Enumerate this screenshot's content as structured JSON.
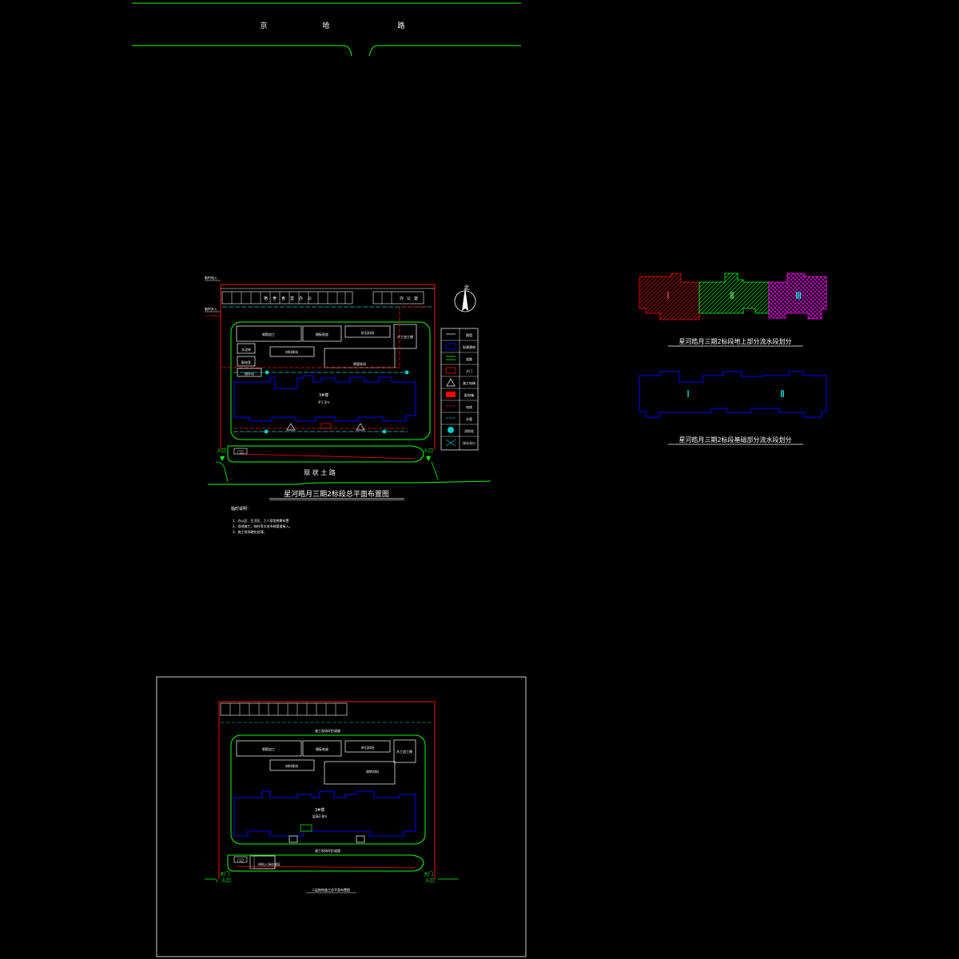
{
  "road_top": {
    "chars": [
      "京",
      "哈",
      "路"
    ]
  },
  "main_plan": {
    "title": "星河皓月三期2标段总平面布置图",
    "road_label": "现 状 土 路",
    "building_name": "3#楼",
    "building_area": "平1.5m",
    "north": "北",
    "entrance_left": "入口",
    "entrance_right": "入口",
    "gate_label": "门卫",
    "top_row_labels": [
      "宿",
      "舍",
      "食",
      "堂",
      "办",
      "公"
    ],
    "top_right_labels": [
      "办",
      "公",
      "室"
    ],
    "left_edge_labels": [
      "临时电入",
      "临时水入"
    ],
    "sheds": [
      "钢筋加工",
      "模板堆放",
      "砂石料场",
      "木工加工棚",
      "材料堆场",
      "钢管堆场"
    ],
    "small_labels": [
      "水泥库",
      "配电室",
      "搅拌站"
    ],
    "legend": [
      {
        "label": "围墙"
      },
      {
        "label": "拟建建筑"
      },
      {
        "label": "道路"
      },
      {
        "label": "大门"
      },
      {
        "label": "施工电梯"
      },
      {
        "label": "配电箱"
      },
      {
        "label": "电线"
      },
      {
        "label": "水管"
      },
      {
        "label": "消防栓"
      },
      {
        "label": "排水沟口"
      }
    ],
    "notes_title": "临时说明：",
    "notes": [
      "1、办公区、生活区、工人宿舍统筹布置",
      "2、场地施工，临时用水由市政管道接入。",
      "3、施工现场硬化处理。"
    ]
  },
  "plan_ground": {
    "title": "星河皓月三期2标段地上部分流水段划分",
    "sections": [
      "Ⅰ",
      "Ⅱ",
      "Ⅲ"
    ]
  },
  "plan_found": {
    "title": "星河皓月三期2标段基础部分流水段划分",
    "sections": [
      "Ⅰ",
      "Ⅱ"
    ]
  },
  "second_plan": {
    "title": "二层结构施工总平面布置图",
    "top_road_label": "施工现场环形道路",
    "bottom_road_label": "施工现场环形道路",
    "building_name": "3#楼",
    "building_area": "层高2.8m",
    "sheds": [
      "钢筋加工",
      "模板堆放",
      "砂石料场",
      "木工加工棚",
      "材料堆场",
      "周转材料"
    ],
    "bottom_box_label": "材料入场存放区",
    "entrance_left": [
      "大门",
      "入口"
    ],
    "entrance_right": [
      "大门",
      "入口"
    ],
    "gate_label": "门卫"
  },
  "colors": {
    "wall": "#ff0000",
    "road": "#00ff00",
    "building": "#0000ff",
    "water": "#00cccc",
    "section1": "#ff0000",
    "section2": "#00ff00",
    "section3": "#ff00ff"
  }
}
